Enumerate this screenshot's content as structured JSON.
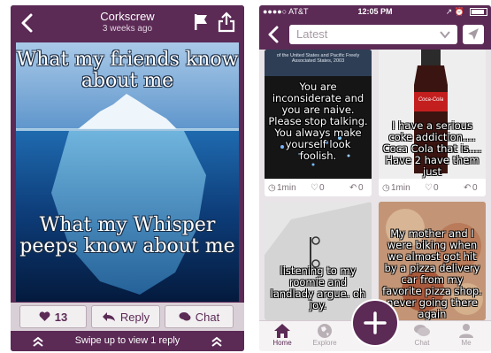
{
  "left": {
    "header": {
      "title": "Corkscrew",
      "timestamp": "3 weeks ago",
      "back_icon": "chevron-left-icon",
      "flag_icon": "flag-icon",
      "share_icon": "share-icon"
    },
    "image": {
      "caption_top": "What my friends know about me",
      "caption_bottom": "What my Whisper peeps know about me"
    },
    "actions": {
      "like_count": "13",
      "reply_label": "Reply",
      "chat_label": "Chat"
    },
    "footer": {
      "swipe_text": "Swipe up to view 1 reply"
    }
  },
  "right": {
    "status": {
      "carrier": "●●●●○ AT&T",
      "time": "12:05 PM",
      "icons": "↗ ⏰"
    },
    "nav": {
      "filter_value": "Latest"
    },
    "cards": [
      {
        "message": "You are inconsiderate and you are naive. Please stop talking. You always make yourself look foolish.",
        "image_text": "of the United States and Pacific Freely Associated States, 2003",
        "time": "1min",
        "hearts": "0",
        "replies": "0"
      },
      {
        "message": "I have a serious coke addiction.... Coca Cola that is.... Have 2 have them just",
        "image_text": "Coca-Cola",
        "time": "1min",
        "hearts": "0",
        "replies": "0"
      },
      {
        "message": "listening to my roomie and landlady argue. oh joy.",
        "image_text": "",
        "time": "",
        "hearts": "",
        "replies": ""
      },
      {
        "message": "My mother and I were biking when we almost got hit by a pizza delivery car from my favorite pizza shop. never going there again",
        "image_text": "",
        "time": "",
        "hearts": "",
        "replies": ""
      }
    ],
    "tabs": [
      {
        "label": "Home",
        "icon": "home-icon"
      },
      {
        "label": "Explore",
        "icon": "globe-icon"
      },
      {
        "label": "Chat",
        "icon": "chat-icon"
      },
      {
        "label": "Me",
        "icon": "person-icon"
      }
    ],
    "colors": {
      "brand": "#5b2a55",
      "feed_bg": "#e8e4e7"
    }
  }
}
